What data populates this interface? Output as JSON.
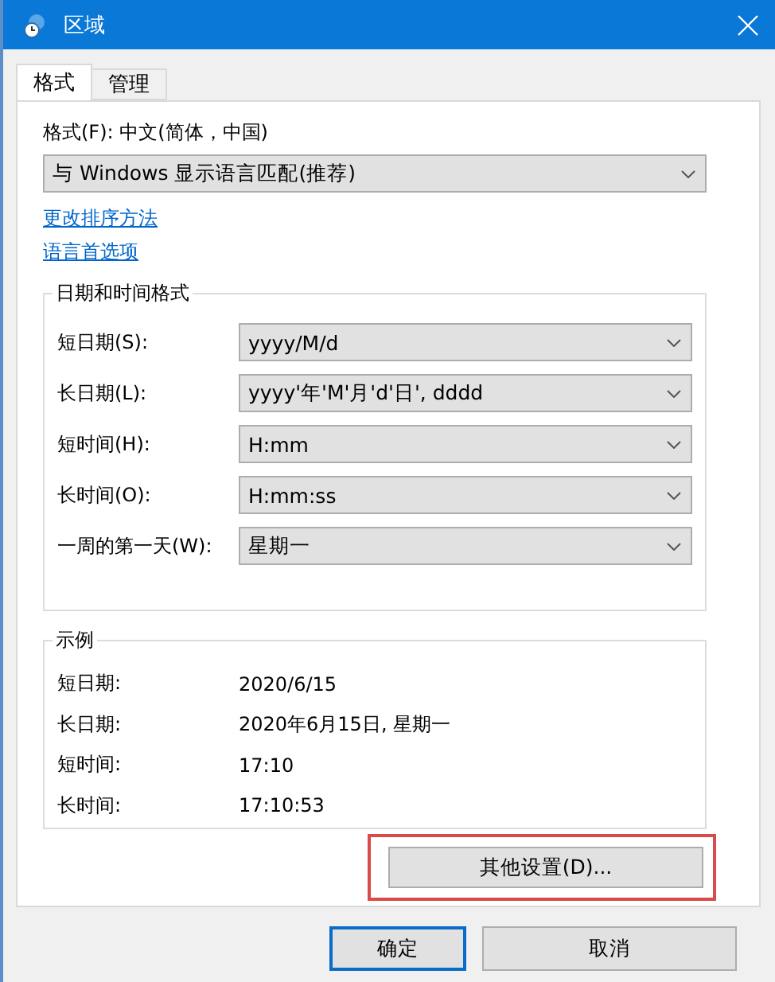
{
  "window": {
    "title": "区域"
  },
  "tabs": [
    {
      "label": "格式",
      "selected": true
    },
    {
      "label": "管理",
      "selected": false
    }
  ],
  "format": {
    "label": "格式(F): 中文(简体，中国)",
    "value": "与 Windows 显示语言匹配(推荐)"
  },
  "links": [
    "更改排序方法",
    "语言首选项"
  ],
  "date_time_formats": {
    "title": "日期和时间格式",
    "rows": [
      {
        "label": "短日期(S):",
        "value": "yyyy/M/d"
      },
      {
        "label": "长日期(L):",
        "value": "yyyy'年'M'月'd'日', dddd"
      },
      {
        "label": "短时间(H):",
        "value": "H:mm"
      },
      {
        "label": "长时间(O):",
        "value": "H:mm:ss"
      },
      {
        "label": "一周的第一天(W):",
        "value": "星期一"
      }
    ]
  },
  "examples": {
    "title": "示例",
    "rows": [
      {
        "label": "短日期:",
        "value": "2020/6/15"
      },
      {
        "label": "长日期:",
        "value": "2020年6月15日, 星期一"
      },
      {
        "label": "短时间:",
        "value": "17:10"
      },
      {
        "label": "长时间:",
        "value": "17:10:53"
      }
    ]
  },
  "additional_settings": {
    "label": "其他设置(D)...",
    "highlighted": true
  },
  "buttons": [
    {
      "label": "确定",
      "default": true
    },
    {
      "label": "取消",
      "default": false
    }
  ]
}
